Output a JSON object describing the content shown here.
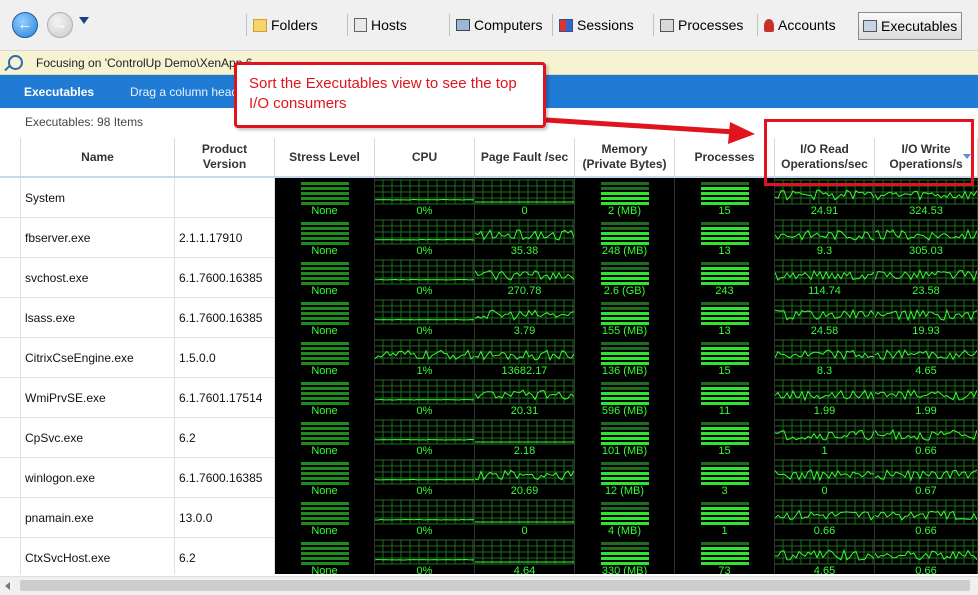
{
  "toolbar": {
    "tabs": [
      {
        "label": "Folders",
        "icon": "folder-icon"
      },
      {
        "label": "Hosts",
        "icon": "hosts-icon"
      },
      {
        "label": "Computers",
        "icon": "computer-icon"
      },
      {
        "label": "Sessions",
        "icon": "sessions-icon"
      },
      {
        "label": "Processes",
        "icon": "processes-icon"
      },
      {
        "label": "Accounts",
        "icon": "accounts-icon"
      },
      {
        "label": "Executables",
        "icon": "executables-icon",
        "active": true
      }
    ]
  },
  "focus_bar": {
    "text": "Focusing on 'ControlUp Demo\\XenApp 6"
  },
  "blue_bar": {
    "title": "Executables",
    "hint": "Drag a column heade"
  },
  "item_count": "Executables: 98 Items",
  "callout": {
    "text": "Sort the Executables view to see the top I/O consumers"
  },
  "columns": [
    "Name",
    "Product Version",
    "Stress Level",
    "CPU",
    "Page Fault /sec",
    "Memory (Private Bytes)",
    "Processes",
    "I/O Read Operations/sec",
    "I/O Write Operations/s"
  ],
  "rows": [
    {
      "name": "System",
      "version": "",
      "stress": "None",
      "cpu": "0%",
      "pagefault": "0",
      "memory": "2 (MB)",
      "processes": "15",
      "io_read": "24.91",
      "io_write": "324.53"
    },
    {
      "name": "fbserver.exe",
      "version": "2.1.1.17910",
      "stress": "None",
      "cpu": "0%",
      "pagefault": "35.38",
      "memory": "248 (MB)",
      "processes": "13",
      "io_read": "9.3",
      "io_write": "305.03"
    },
    {
      "name": "svchost.exe",
      "version": "6.1.7600.16385",
      "stress": "None",
      "cpu": "0%",
      "pagefault": "270.78",
      "memory": "2.6 (GB)",
      "processes": "243",
      "io_read": "114.74",
      "io_write": "23.58"
    },
    {
      "name": "lsass.exe",
      "version": "6.1.7600.16385",
      "stress": "None",
      "cpu": "0%",
      "pagefault": "3.79",
      "memory": "155 (MB)",
      "processes": "13",
      "io_read": "24.58",
      "io_write": "19.93"
    },
    {
      "name": "CitrixCseEngine.exe",
      "version": "1.5.0.0",
      "stress": "None",
      "cpu": "1%",
      "pagefault": "13682.17",
      "memory": "136 (MB)",
      "processes": "15",
      "io_read": "8.3",
      "io_write": "4.65"
    },
    {
      "name": "WmiPrvSE.exe",
      "version": "6.1.7601.17514",
      "stress": "None",
      "cpu": "0%",
      "pagefault": "20.31",
      "memory": "596 (MB)",
      "processes": "11",
      "io_read": "1.99",
      "io_write": "1.99"
    },
    {
      "name": "CpSvc.exe",
      "version": "6.2",
      "stress": "None",
      "cpu": "0%",
      "pagefault": "2.18",
      "memory": "101 (MB)",
      "processes": "15",
      "io_read": "1",
      "io_write": "0.66"
    },
    {
      "name": "winlogon.exe",
      "version": "6.1.7600.16385",
      "stress": "None",
      "cpu": "0%",
      "pagefault": "20.69",
      "memory": "12 (MB)",
      "processes": "3",
      "io_read": "0",
      "io_write": "0.67"
    },
    {
      "name": "pnamain.exe",
      "version": "13.0.0",
      "stress": "None",
      "cpu": "0%",
      "pagefault": "0",
      "memory": "4 (MB)",
      "processes": "1",
      "io_read": "0.66",
      "io_write": "0.66"
    },
    {
      "name": "CtxSvcHost.exe",
      "version": "6.2",
      "stress": "None",
      "cpu": "0%",
      "pagefault": "4.64",
      "memory": "330 (MB)",
      "processes": "73",
      "io_read": "4.65",
      "io_write": "0.66"
    }
  ],
  "colors": {
    "accent_blue": "#1f7bd4",
    "graph_green": "#33ff33",
    "callout_red": "#e0141e"
  }
}
